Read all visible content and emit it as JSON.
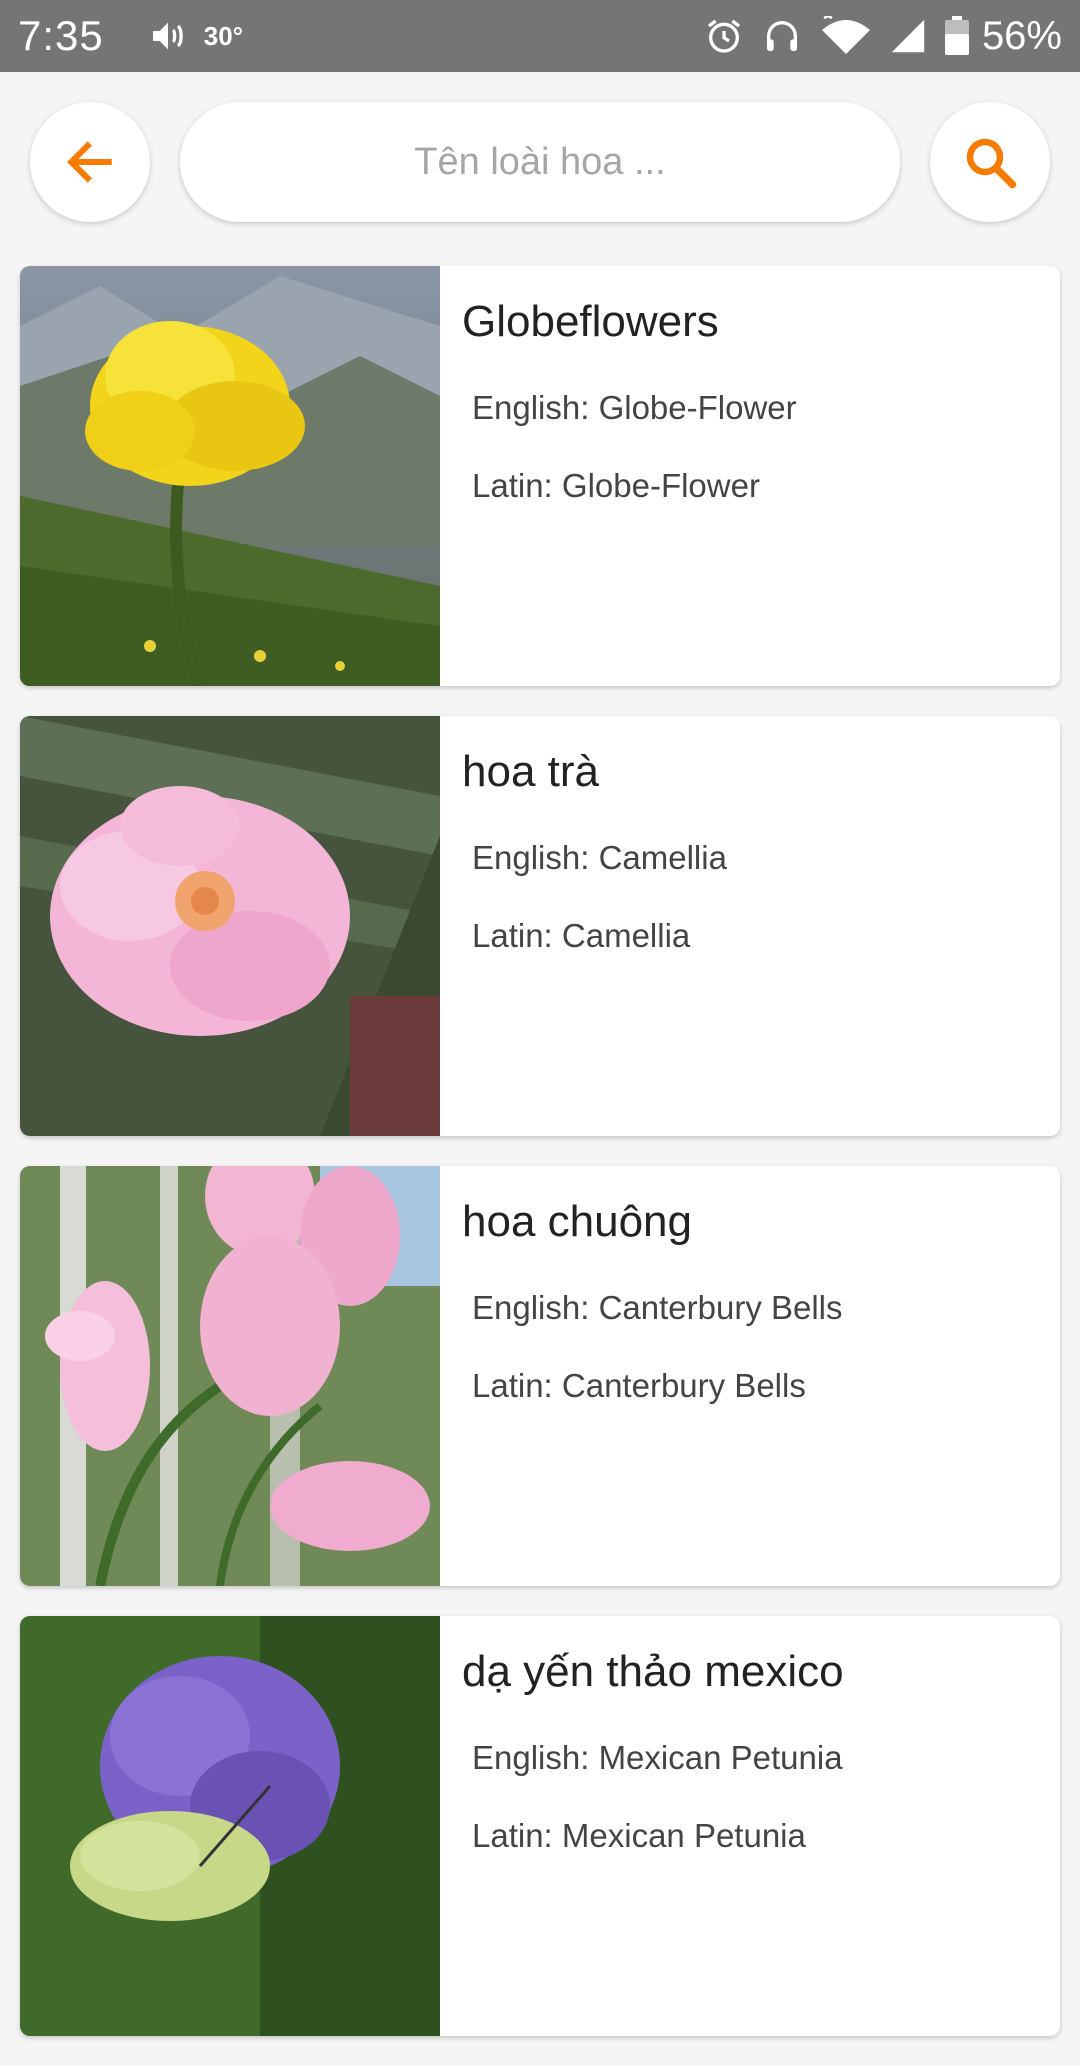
{
  "status_bar": {
    "time": "7:35",
    "temperature": "30°",
    "battery_percent": "56%"
  },
  "header": {
    "search_placeholder": "Tên loài hoa ...",
    "accent_color": "#f57c00"
  },
  "flowers": [
    {
      "name": "Globeflowers",
      "english": "English: Globe-Flower",
      "latin": "Latin: Globe-Flower",
      "image_subject": "yellow-globeflower"
    },
    {
      "name": "hoa trà",
      "english": "English: Camellia",
      "latin": "Latin: Camellia",
      "image_subject": "pink-camellia"
    },
    {
      "name": "hoa chuông",
      "english": "English: Canterbury Bells",
      "latin": "Latin: Canterbury Bells",
      "image_subject": "pink-canterbury-bells"
    },
    {
      "name": "dạ yến thảo mexico",
      "english": "English: Mexican Petunia",
      "latin": "Latin: Mexican Petunia",
      "image_subject": "purple-mexican-petunia"
    }
  ]
}
